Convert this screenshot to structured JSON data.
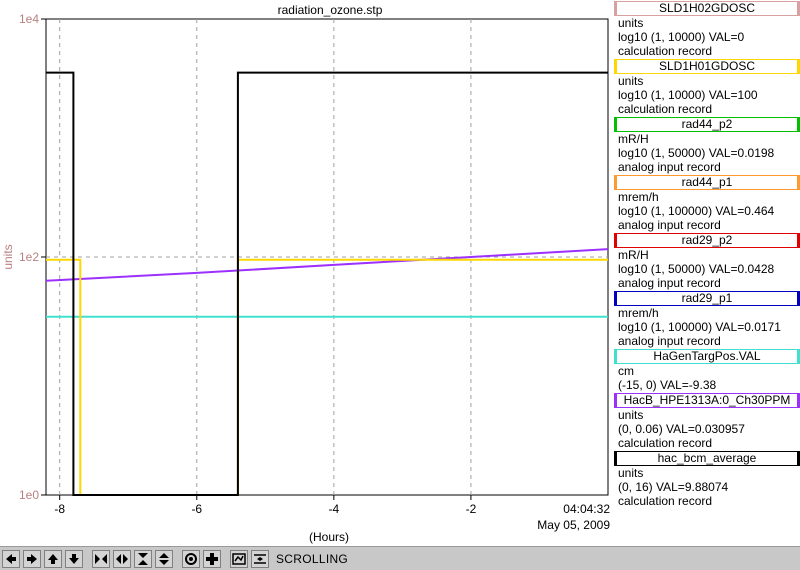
{
  "chart_data": {
    "type": "line",
    "title": "radiation_ozone.stp",
    "ylabel": "units",
    "xlabel": "(Hours)",
    "y_scale": "log10",
    "ylim": [
      1,
      10000
    ],
    "xlim": [
      -8.2,
      0
    ],
    "y_ticks": [
      {
        "value": 1,
        "label": "1e0"
      },
      {
        "value": 100,
        "label": "1e2"
      },
      {
        "value": 10000,
        "label": "1e4"
      }
    ],
    "x_ticks": [
      {
        "value": -8,
        "label": "-8"
      },
      {
        "value": -6,
        "label": "-6"
      },
      {
        "value": -4,
        "label": "-4"
      },
      {
        "value": -2,
        "label": "-2"
      }
    ],
    "end_time": "04:04:32",
    "end_date": "May 05, 2009",
    "grid": true,
    "series": [
      {
        "name": "HacB_HPE1313A:0_Ch30PPM",
        "color": "#9b30ff",
        "display_range": [
          0,
          0.06
        ],
        "x": [
          -8.2,
          -6,
          -4,
          -2,
          0
        ],
        "values": [
          0.027,
          0.028,
          0.029,
          0.03,
          0.031
        ]
      },
      {
        "name": "HaGenTargPos.VAL",
        "color": "#40e0d0",
        "display_range": [
          -15,
          0
        ],
        "x": [
          -8.2,
          0
        ],
        "values": [
          -9.38,
          -9.38
        ]
      },
      {
        "name": "SLD1H01GDOSC",
        "color": "#ffd700",
        "display_range": [
          1,
          10000
        ],
        "x": [
          -8.2,
          -8.0,
          -7.7,
          -7.7,
          -5.4,
          -5.4,
          -4.8,
          -4.0,
          -3.0,
          -2.0,
          -1.0,
          0
        ],
        "values": [
          95,
          95,
          95,
          1,
          1,
          95,
          95,
          95,
          95,
          95,
          95,
          95
        ]
      },
      {
        "name": "hac_bcm_average",
        "color": "#000000",
        "display_range": [
          0,
          16
        ],
        "x": [
          -8.2,
          -7.8,
          -7.8,
          -5.4,
          -5.4,
          -4.4,
          -3.9,
          -3.0,
          -2.0,
          -1.0,
          0
        ],
        "values": [
          14.2,
          14.2,
          0,
          0,
          14.2,
          14.2,
          14.2,
          14.2,
          14.2,
          14.2,
          14.2
        ]
      }
    ]
  },
  "legend": [
    {
      "name": "SLD1H02GDOSC",
      "color": "#d8a0a0",
      "unit": "units",
      "range": "log10 (1, 10000)  VAL=0",
      "record": "calculation record"
    },
    {
      "name": "SLD1H01GDOSC",
      "color": "#ffd700",
      "unit": "units",
      "range": "log10 (1, 10000) VAL=100",
      "record": "calculation record"
    },
    {
      "name": "rad44_p2",
      "color": "#00c000",
      "unit": "mR/H",
      "range": "log10 (1, 50000) VAL=0.0198",
      "record": "analog input record"
    },
    {
      "name": "rad44_p1",
      "color": "#ff9a30",
      "unit": "mrem/h",
      "range": "log10 (1, 100000) VAL=0.464",
      "record": "analog input record"
    },
    {
      "name": "rad29_p2",
      "color": "#e00000",
      "unit": "mR/H",
      "range": "log10 (1, 50000) VAL=0.0428",
      "record": "analog input record"
    },
    {
      "name": "rad29_p1",
      "color": "#0000c0",
      "unit": "mrem/h",
      "range": "log10 (1, 100000) VAL=0.0171",
      "record": "analog input record"
    },
    {
      "name": "HaGenTargPos.VAL",
      "color": "#40e0d0",
      "unit": "cm",
      "range": "(-15, 0) VAL=-9.38",
      "record": ""
    },
    {
      "name": "HacB_HPE1313A:0_Ch30PPM",
      "color": "#9b30ff",
      "unit": "units",
      "range": "(0, 0.06) VAL=0.030957",
      "record": "calculation record"
    },
    {
      "name": "hac_bcm_average",
      "color": "#000000",
      "unit": "units",
      "range": "(0, 16) VAL=9.88074",
      "record": "calculation record"
    }
  ],
  "toolbar": {
    "status": "SCROLLING",
    "buttons": [
      "arrow-left-icon",
      "arrow-right-icon",
      "arrow-up-icon",
      "arrow-down-icon",
      "zoom-in-horizontal-icon",
      "zoom-out-horizontal-icon",
      "zoom-in-vertical-icon",
      "zoom-out-vertical-icon",
      "autoscale-icon",
      "reset-icon",
      "config-icon",
      "scroll-icon"
    ]
  }
}
